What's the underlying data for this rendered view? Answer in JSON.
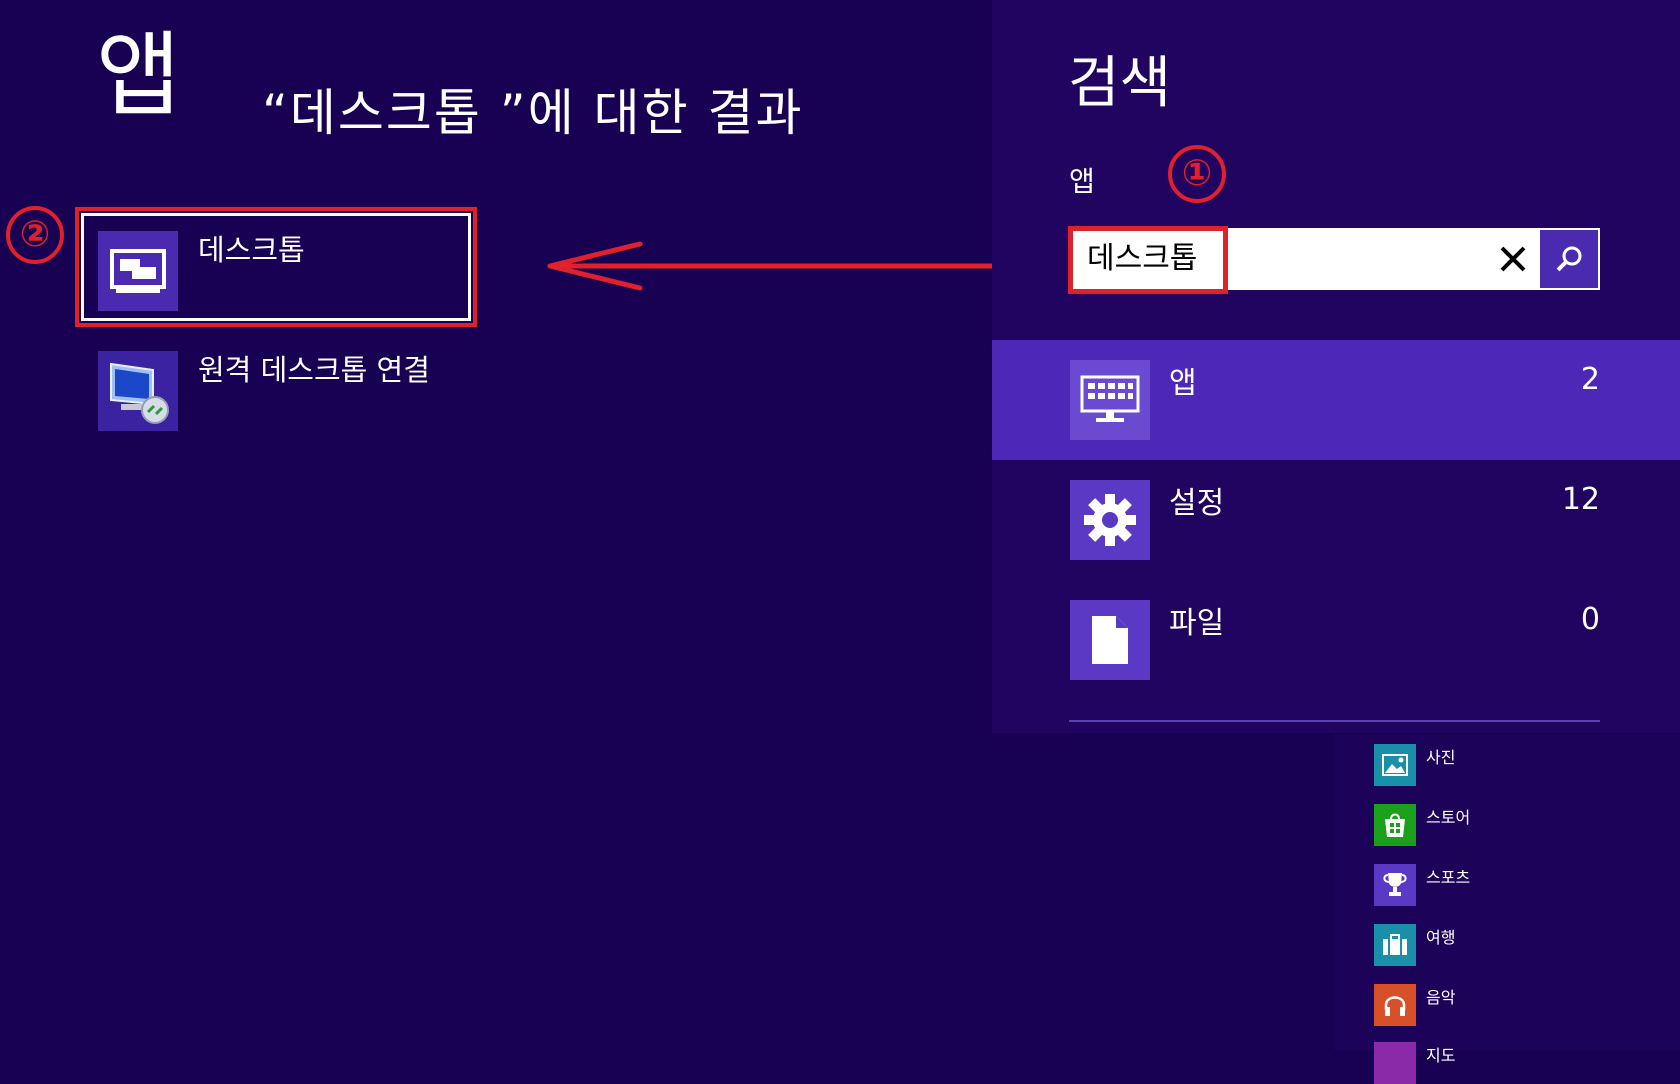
{
  "results": {
    "title": "앱",
    "subtitle": "“데스크톱 ”에 대한 결과",
    "items": [
      {
        "label": "데스크톱",
        "icon": "desktop-icon",
        "highlighted": true
      },
      {
        "label": "원격 데스크톱 연결",
        "icon": "remote-desktop-icon",
        "highlighted": false
      }
    ]
  },
  "annotations": {
    "step1": "①",
    "step2": "②",
    "color": "#e0202a"
  },
  "search": {
    "pane_title": "검색",
    "scope_label": "앱",
    "query": "데스크톱",
    "clear_icon": "close-icon",
    "submit_icon": "search-icon"
  },
  "categories": [
    {
      "name": "앱",
      "count": "2",
      "icon": "keyboard-icon",
      "selected": true
    },
    {
      "name": "설정",
      "count": "12",
      "icon": "gear-icon",
      "selected": false
    },
    {
      "name": "파일",
      "count": "0",
      "icon": "file-icon",
      "selected": false
    }
  ],
  "start_apps": [
    {
      "name": "사진",
      "icon": "photo-icon",
      "color": "#1a8fa8"
    },
    {
      "name": "스토어",
      "icon": "store-icon",
      "color": "#1aa01a"
    },
    {
      "name": "스포츠",
      "icon": "trophy-icon",
      "color": "#5a3ac4"
    },
    {
      "name": "여행",
      "icon": "suitcase-icon",
      "color": "#1a8fa8"
    },
    {
      "name": "음악",
      "icon": "headphones-icon",
      "color": "#d8502a"
    },
    {
      "name": "지도",
      "icon": "map-icon",
      "color": "#8a2aa8"
    }
  ],
  "colors": {
    "background": "#180052",
    "pane": "#200460",
    "selected": "#4d28b8",
    "tile": "#4a2bb0",
    "highlight": "#e0202a"
  }
}
